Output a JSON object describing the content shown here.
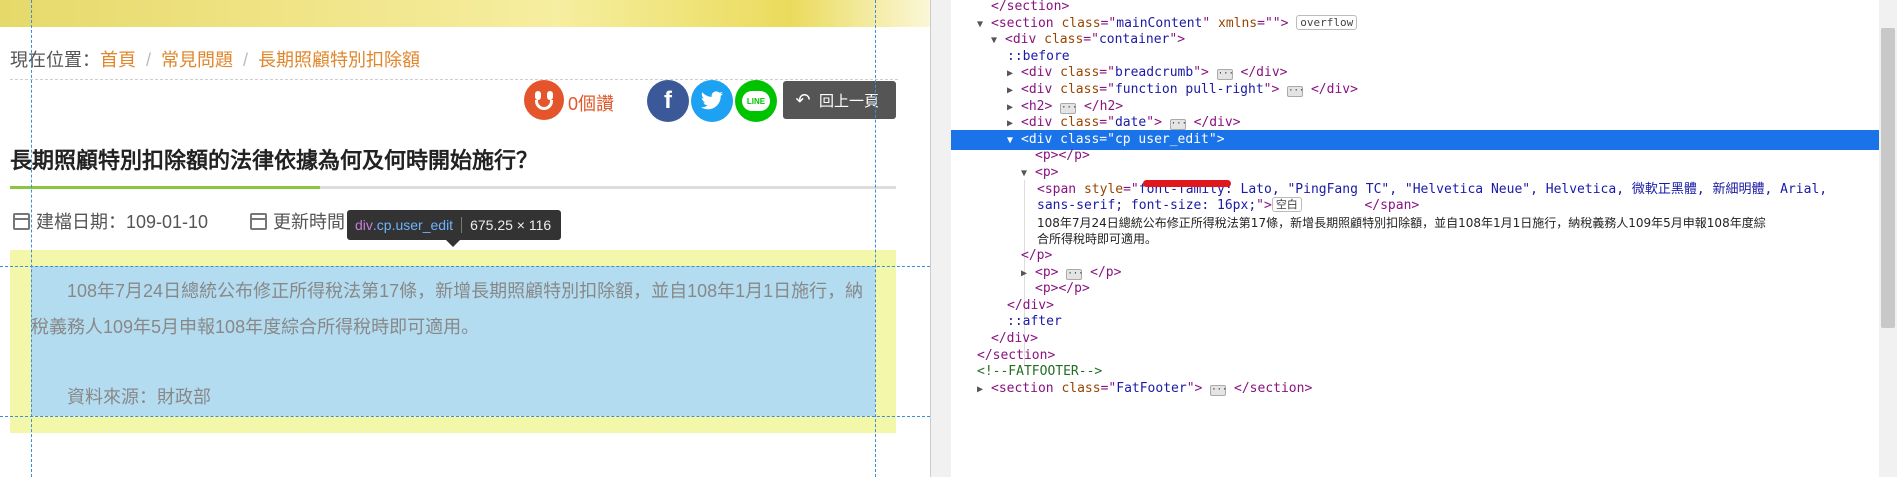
{
  "breadcrumb": {
    "prefix": "現在位置：",
    "items": [
      "首頁",
      "常見問題",
      "長期照顧特別扣除額"
    ],
    "separator": "/"
  },
  "social": {
    "like_count": "0個讚",
    "back_label": "回上一頁",
    "facebook_glyph": "f",
    "twitter_glyph": "t",
    "line_glyph": "LINE"
  },
  "article": {
    "title": "長期照顧特別扣除額的法律依據為何及何時開始施行？",
    "created": "建檔日期：109-01-10",
    "updated": "更新時間",
    "body": "108年7月24日總統公布修正所得稅法第17條，新增長期照顧特別扣除額，並自108年1月1日施行，納稅義務人109年5月申報108年度綜合所得稅時即可適用。",
    "source": "資料來源：財政部"
  },
  "inspector_tooltip": {
    "tag": "div",
    "selector": ".cp.user_edit",
    "dims": "675.25 × 116"
  },
  "devtools": {
    "lines": [
      {
        "indent": 2,
        "tri": "",
        "html": "</section>"
      },
      {
        "indent": 1,
        "tri": "▼",
        "tag": "section",
        "attrs": [
          [
            "class",
            "mainContent"
          ],
          [
            "xmlns",
            ""
          ]
        ],
        "badge": "overflow"
      },
      {
        "indent": 2,
        "tri": "▼",
        "tag": "div",
        "attrs": [
          [
            "class",
            "container"
          ]
        ]
      },
      {
        "indent": 3,
        "pseudo": "::before"
      },
      {
        "indent": 3,
        "tri": "▶",
        "tag": "div",
        "attrs": [
          [
            "class",
            "breadcrumb"
          ]
        ],
        "collapsed": true,
        "close": "div"
      },
      {
        "indent": 3,
        "tri": "▶",
        "tag": "div",
        "attrs": [
          [
            "class",
            "function pull-right"
          ]
        ],
        "collapsed": true,
        "close": "div"
      },
      {
        "indent": 3,
        "tri": "▶",
        "tag": "h2",
        "attrs": [],
        "collapsed": true,
        "close": "h2"
      },
      {
        "indent": 3,
        "tri": "▶",
        "tag": "div",
        "attrs": [
          [
            "class",
            "date"
          ]
        ],
        "collapsed": true,
        "close": "div"
      },
      {
        "indent": 3,
        "tri": "▼",
        "tag": "div",
        "attrs": [
          [
            "class",
            "cp user_edit"
          ]
        ],
        "selected": true
      },
      {
        "indent": 4,
        "tag": "p",
        "close": "p",
        "empty": true
      },
      {
        "indent": 4,
        "tri": "▼",
        "tag": "p",
        "attrs": []
      },
      {
        "indent": 5,
        "span_open": true
      },
      {
        "indent": 5,
        "span_cont": true
      },
      {
        "indent": 5,
        "text_node": true
      },
      {
        "indent": 5,
        "text_node2": true
      },
      {
        "indent": 4,
        "html": "</p>"
      },
      {
        "indent": 4,
        "tri": "▶",
        "tag": "p",
        "attrs": [],
        "collapsed": true,
        "close": "p"
      },
      {
        "indent": 4,
        "tag": "p",
        "close": "p",
        "empty": true
      },
      {
        "indent": 3,
        "html": "</div>"
      },
      {
        "indent": 3,
        "pseudo": "::after"
      },
      {
        "indent": 2,
        "html": "</div>"
      },
      {
        "indent": 1,
        "html": "</section>"
      },
      {
        "indent": 1,
        "comment": "<!--FATFOOTER-->"
      },
      {
        "indent": 1,
        "tri": "▶",
        "tag": "section",
        "attrs": [
          [
            "class",
            "FatFooter"
          ]
        ],
        "collapsed": true,
        "close": "section"
      }
    ],
    "span_style_1": "font-family: Lato, \"PingFang TC\", \"Helvetica Neue\", Helvetica, 微軟正黑體, 新細明體, Arial,",
    "span_style_2": "sans-serif; font-size: 16px;",
    "span_badge": "空白",
    "text_line_1": "108年7月24日總統公布修正所得稅法第17條，新增長期照顧特別扣除額，並自108年1月1日施行，納稅義務人109年5月申報108年度綜",
    "text_line_2": "合所得稅時即可適用。",
    "colors": {
      "selection": "#1a73e8",
      "tag": "#881280",
      "attr": "#994500",
      "value": "#1a1aa6",
      "comment": "#236e25"
    }
  }
}
